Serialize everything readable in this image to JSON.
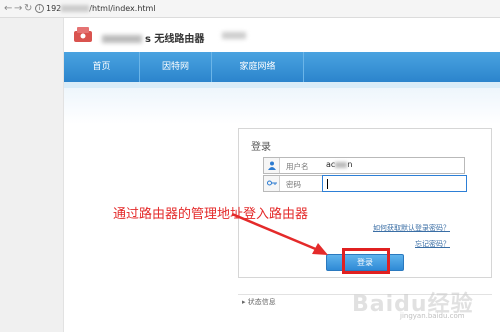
{
  "browser": {
    "url_prefix": "192",
    "url_suffix": "/html/index.html"
  },
  "header": {
    "brand_text": "s 无线路由器"
  },
  "nav": {
    "items": [
      {
        "label": "首页"
      },
      {
        "label": "因特网"
      },
      {
        "label": "家庭网络"
      }
    ]
  },
  "login": {
    "title": "登录",
    "username_label": "用户名",
    "username_value_start": "ac",
    "username_value_end": "n",
    "password_label": "密码",
    "forgot_username_link": "如何获取默认登录密码？",
    "forgot_password_link": "忘记密码？",
    "login_button": "登录",
    "status_label": "状态信息"
  },
  "annotation": {
    "text": "通过路由器的管理地址登入路由器",
    "color": "#e42a2a"
  },
  "watermark": {
    "text": "Baidu经验",
    "sub": "jingyan.baidu.com"
  },
  "colors": {
    "nav_blue": "#2c84cc",
    "highlight_red": "#e02020"
  }
}
